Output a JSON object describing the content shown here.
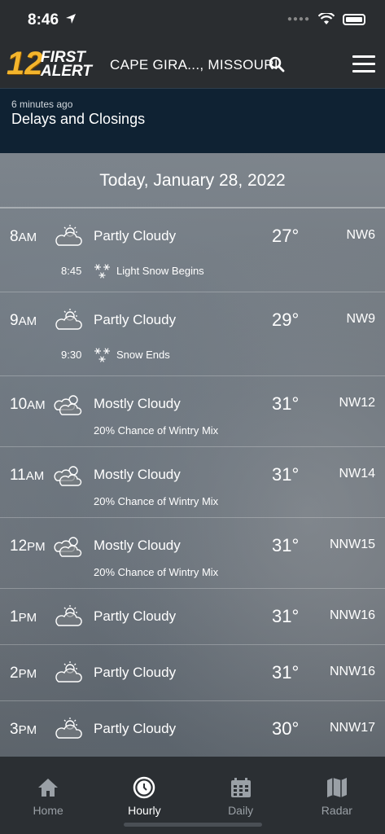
{
  "status_bar": {
    "time": "8:46"
  },
  "header": {
    "logo_number": "12",
    "logo_line1": "FIRST",
    "logo_line2": "ALERT",
    "location": "CAPE GIRA..., MISSOURI"
  },
  "alert": {
    "time_ago": "6 minutes ago",
    "title": "Delays and Closings"
  },
  "date_heading": "Today, January 28, 2022",
  "hours": [
    {
      "hour": "8",
      "ampm": "AM",
      "icon": "partly-cloudy-icon",
      "condition": "Partly Cloudy",
      "temp": "27°",
      "wind": "NW6",
      "event_time": "8:45",
      "event_icon": "snow-icon",
      "event_text": "Light Snow Begins"
    },
    {
      "hour": "9",
      "ampm": "AM",
      "icon": "partly-cloudy-icon",
      "condition": "Partly Cloudy",
      "temp": "29°",
      "wind": "NW9",
      "event_time": "9:30",
      "event_icon": "snow-icon",
      "event_text": "Snow Ends"
    },
    {
      "hour": "10",
      "ampm": "AM",
      "icon": "mostly-cloudy-icon",
      "condition": "Mostly Cloudy",
      "temp": "31°",
      "wind": "NW12",
      "chance": "20% Chance of Wintry Mix"
    },
    {
      "hour": "11",
      "ampm": "AM",
      "icon": "mostly-cloudy-icon",
      "condition": "Mostly Cloudy",
      "temp": "31°",
      "wind": "NW14",
      "chance": "20% Chance of Wintry Mix"
    },
    {
      "hour": "12",
      "ampm": "PM",
      "icon": "mostly-cloudy-icon",
      "condition": "Mostly Cloudy",
      "temp": "31°",
      "wind": "NNW15",
      "chance": "20% Chance of Wintry Mix"
    },
    {
      "hour": "1",
      "ampm": "PM",
      "icon": "partly-cloudy-icon",
      "condition": "Partly Cloudy",
      "temp": "31°",
      "wind": "NNW16"
    },
    {
      "hour": "2",
      "ampm": "PM",
      "icon": "partly-cloudy-icon",
      "condition": "Partly Cloudy",
      "temp": "31°",
      "wind": "NNW16"
    },
    {
      "hour": "3",
      "ampm": "PM",
      "icon": "partly-cloudy-icon",
      "condition": "Partly Cloudy",
      "temp": "30°",
      "wind": "NNW17"
    }
  ],
  "tabs": [
    {
      "label": "Home",
      "icon": "home-icon",
      "active": false
    },
    {
      "label": "Hourly",
      "icon": "clock-icon",
      "active": true
    },
    {
      "label": "Daily",
      "icon": "calendar-icon",
      "active": false
    },
    {
      "label": "Radar",
      "icon": "map-icon",
      "active": false
    }
  ]
}
